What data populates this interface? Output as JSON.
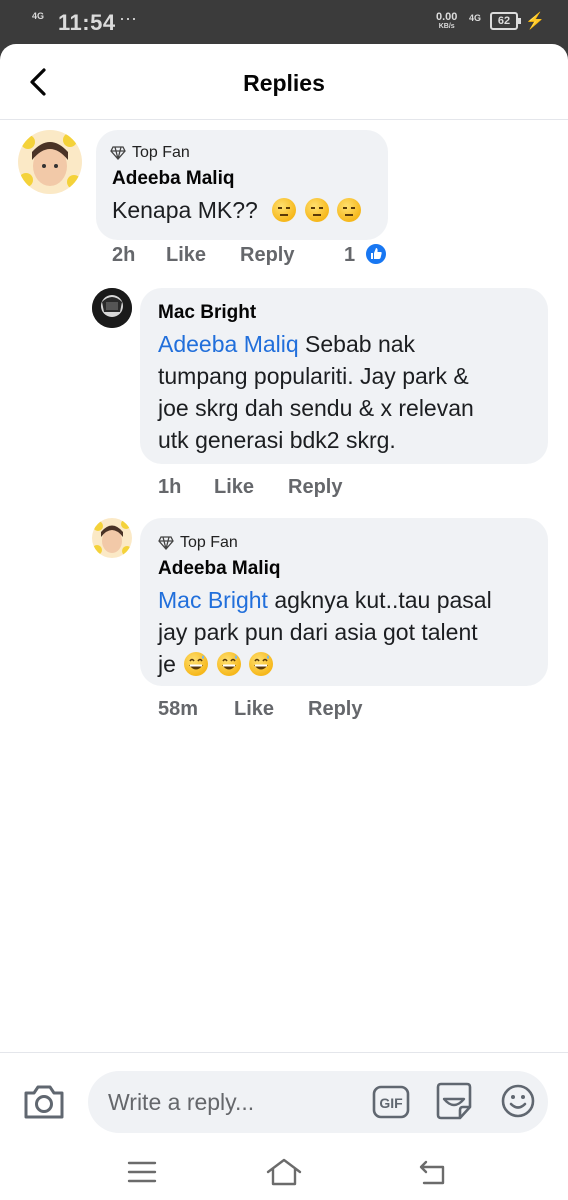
{
  "status_bar": {
    "network": "4G",
    "time": "11:54",
    "more": "···",
    "speed": "0.00",
    "speed_unit": "KB/s",
    "network2": "4G",
    "battery": "62"
  },
  "header": {
    "title": "Replies",
    "back_icon": "chevron-left-icon"
  },
  "comments": [
    {
      "badge": "Top Fan",
      "author": "Adeeba Maliq",
      "text": "Kenapa MK??",
      "emoji": [
        "expressionless-face",
        "expressionless-face",
        "expressionless-face"
      ],
      "time": "2h",
      "like_label": "Like",
      "reply_label": "Reply",
      "reaction_count": "1",
      "reaction_icon": "like-reaction-icon"
    },
    {
      "author": "Mac Bright",
      "mention": "Adeeba Maliq",
      "text_lines": [
        "Sebab nak",
        "tumpang populariti. Jay park &",
        "joe skrg dah sendu & x relevan",
        "utk generasi bdk2 skrg."
      ],
      "time": "1h",
      "like_label": "Like",
      "reply_label": "Reply"
    },
    {
      "badge": "Top Fan",
      "author": "Adeeba Maliq",
      "mention": "Mac Bright",
      "text_lines": [
        "agknya kut..tau pasal",
        "jay park pun dari asia got talent",
        "je"
      ],
      "emoji": [
        "grinning-sweat-face",
        "grinning-sweat-face",
        "grinning-sweat-face"
      ],
      "time": "58m",
      "like_label": "Like",
      "reply_label": "Reply"
    }
  ],
  "composer": {
    "placeholder": "Write a reply...",
    "gif_label": "GIF"
  },
  "colors": {
    "mention": "#216fdb",
    "bubble": "#f0f2f5",
    "meta": "#65676b",
    "like_blue": "#1877f2"
  }
}
